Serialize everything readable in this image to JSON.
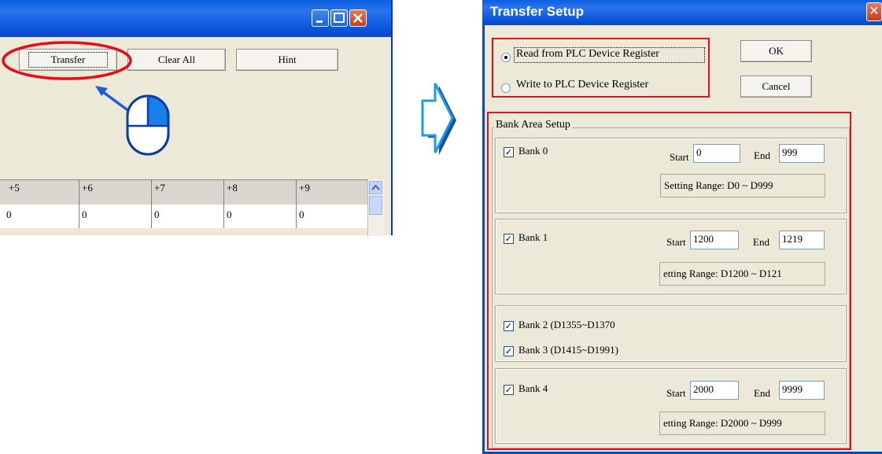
{
  "left_window": {
    "buttons": {
      "transfer": "Transfer",
      "clear_all": "Clear All",
      "hint": "Hint"
    },
    "column_headers": [
      "+5",
      "+6",
      "+7",
      "+8",
      "+9"
    ],
    "row_values": [
      "0",
      "0",
      "0",
      "0",
      "0"
    ]
  },
  "dialog": {
    "title": "Transfer Setup",
    "read_option": "Read from PLC Device Register",
    "write_option": "Write to PLC Device Register",
    "ok_label": "OK",
    "cancel_label": "Cancel",
    "bank_group_title": "Bank Area Setup",
    "start_label": "Start",
    "end_label": "End",
    "banks": [
      {
        "label": "Bank 0",
        "start": "0",
        "end": "999",
        "range": "Setting Range: D0 ~ D999"
      },
      {
        "label": "Bank 1",
        "start": "1200",
        "end": "1219",
        "range": "etting Range: D1200 ~ D121"
      },
      {
        "label": "Bank 2 (D1355~D1370"
      },
      {
        "label": "Bank 3 (D1415~D1991)"
      },
      {
        "label": "Bank 4",
        "start": "2000",
        "end": "9999",
        "range": "etting Range: D2000 ~ D999"
      }
    ]
  },
  "colors": {
    "highlight": "#e3101a",
    "titlebar": "#0a54d8",
    "arrow": "#1c9be6"
  }
}
